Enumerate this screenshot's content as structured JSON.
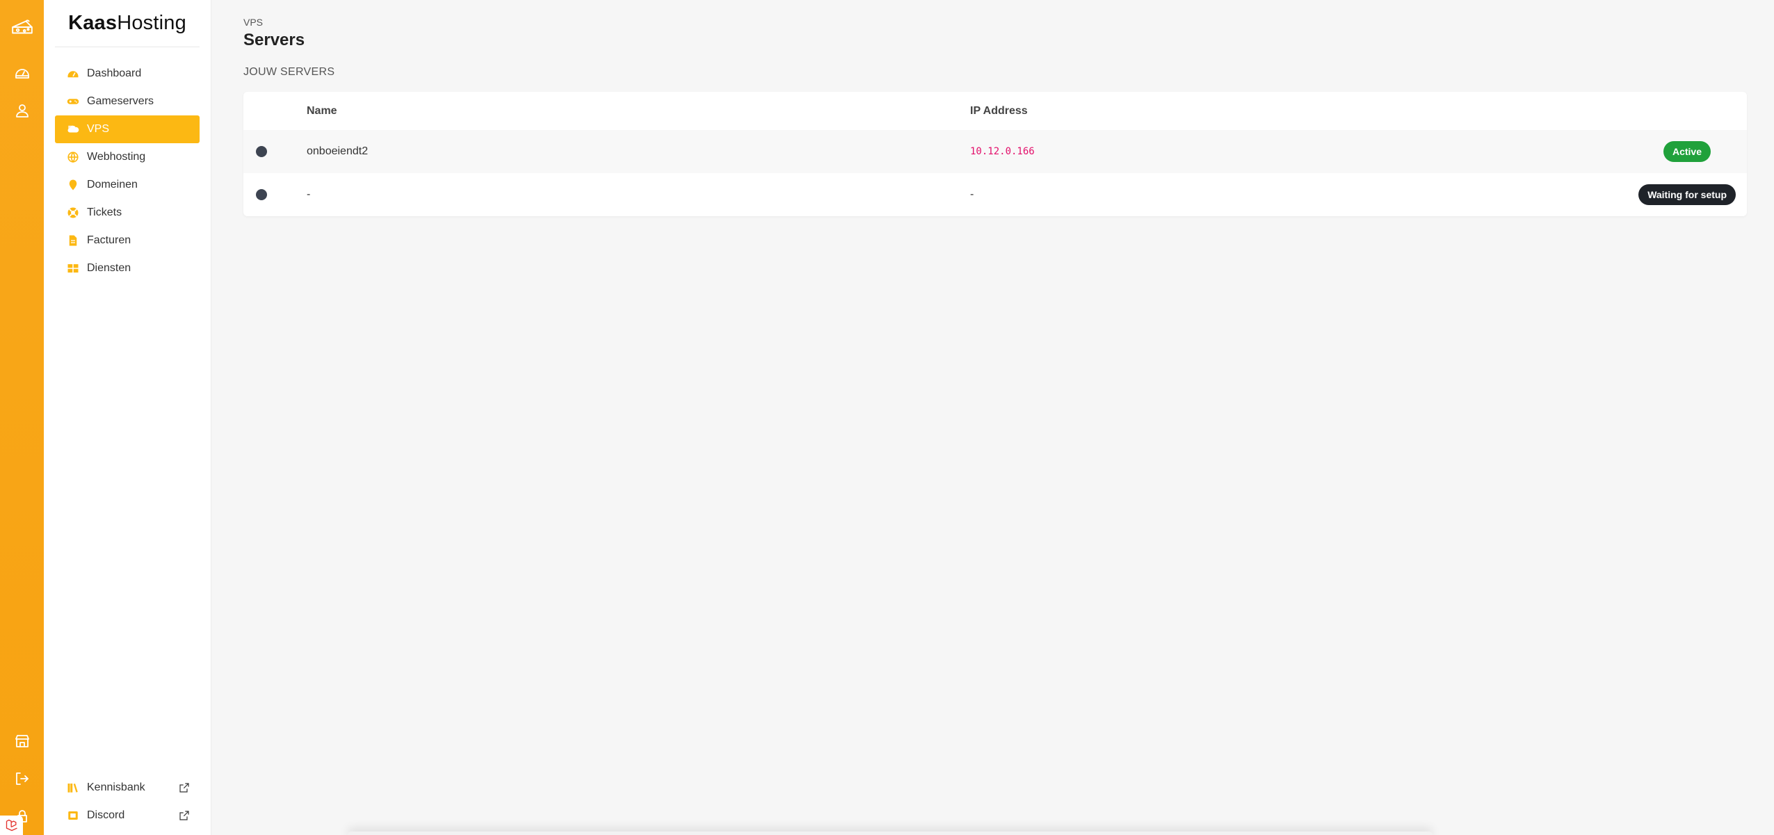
{
  "brand": {
    "bold": "Kaas",
    "light": "Hosting"
  },
  "rail": {
    "top_icons": [
      "cheese-logo-icon",
      "gauge-icon",
      "user-icon"
    ],
    "bottom_icons": [
      "store-icon",
      "logout-icon",
      "lock-icon"
    ]
  },
  "sidebar": {
    "items": [
      {
        "label": "Dashboard",
        "icon": "gauge-icon"
      },
      {
        "label": "Gameservers",
        "icon": "gamepad-icon"
      },
      {
        "label": "VPS",
        "icon": "cloud-icon",
        "active": true
      },
      {
        "label": "Webhosting",
        "icon": "globe-icon"
      },
      {
        "label": "Domeinen",
        "icon": "map-pin-icon"
      },
      {
        "label": "Tickets",
        "icon": "lifebuoy-icon"
      },
      {
        "label": "Facturen",
        "icon": "file-icon"
      },
      {
        "label": "Diensten",
        "icon": "grid-icon"
      }
    ],
    "bottom_items": [
      {
        "label": "Kennisbank",
        "icon": "books-icon"
      },
      {
        "label": "Discord",
        "icon": "discord-icon"
      }
    ]
  },
  "header": {
    "breadcrumb": "VPS",
    "title": "Servers",
    "section": "JOUW SERVERS"
  },
  "table": {
    "columns": [
      "Name",
      "IP Address"
    ],
    "rows": [
      {
        "name": "onboeiendt2",
        "ip": "10.12.0.166",
        "status": "Active"
      },
      {
        "name": "-",
        "ip": "-",
        "status": "Waiting for setup"
      }
    ]
  },
  "colors": {
    "accent": "#fcb813",
    "rail": "#f9a81b",
    "active_badge": "#20a13b",
    "waiting_badge": "#1f2329",
    "ip_text": "#e3106b"
  }
}
